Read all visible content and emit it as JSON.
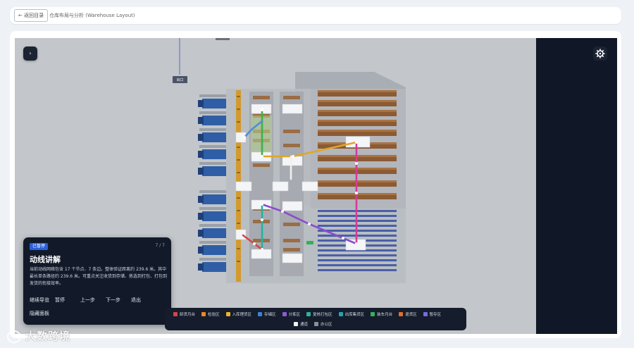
{
  "header": {
    "back_label": "← 返回目录",
    "title": "仓库布局与分析 (Warehouse Layout)"
  },
  "scene": {
    "exit_label": "出口"
  },
  "narration": {
    "badge": "已暂停",
    "step": "7 / 7",
    "title": "动线讲解",
    "text": "当前动线网络包含 17 个节点、7 条边。整体验证距离约 239.6 米。其中最长单条路径约 239.6 米。可重点关注收货到存储、拣选到打包、打包到发货的衔接效率。",
    "buttons": [
      "继续导览",
      "暂停",
      "上一步",
      "下一步",
      "退出"
    ],
    "hide_label": "隐藏面板"
  },
  "legend": {
    "row1": [
      {
        "label": "卸货月台",
        "color": "#d64545"
      },
      {
        "label": "检验区",
        "color": "#e88a2a"
      },
      {
        "label": "入库理货区",
        "color": "#e8b62a"
      },
      {
        "label": "存储区",
        "color": "#3b82d6"
      },
      {
        "label": "分拣区",
        "color": "#8b5cd6"
      },
      {
        "label": "复核打包区",
        "color": "#2ab39a"
      },
      {
        "label": "出库集货区",
        "color": "#22a6b3"
      },
      {
        "label": "装车月台",
        "color": "#2fb35a"
      },
      {
        "label": "退货区",
        "color": "#e0702a"
      },
      {
        "label": "暂存区",
        "color": "#7a6ae0"
      }
    ],
    "row2": [
      {
        "label": "通道",
        "color": "#f2f2f2"
      },
      {
        "label": "办公区",
        "color": "#8a8f98"
      }
    ]
  },
  "watermark": "大数跨境",
  "colors": {
    "panel_bg": "#121a2a",
    "scene_bg": "#c3c6ca",
    "accent": "#2b5fd8"
  }
}
